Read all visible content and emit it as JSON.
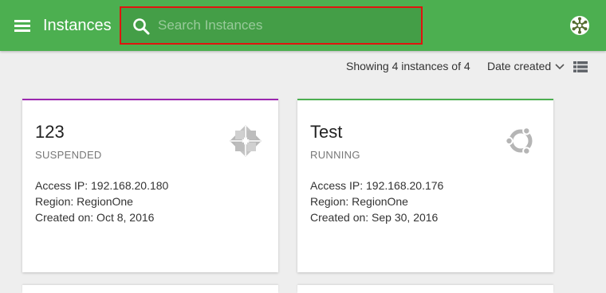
{
  "header": {
    "title": "Instances",
    "search_placeholder": "Search Instances",
    "search_value": "",
    "menu_icon": "hamburger-menu-icon",
    "search_icon": "magnifier-icon",
    "avatar_icon": "snowflake-avatar-icon",
    "color": "#4caf50",
    "highlight_color": "#e0140f"
  },
  "toolbar": {
    "count_text": "Showing 4 instances of 4",
    "sort_label": "Date created",
    "sort_icon": "chevron-down-icon",
    "view_icon": "list-view-icon"
  },
  "instances": [
    {
      "name": "123",
      "status": "SUSPENDED",
      "status_color": "#9c27b0",
      "access_ip": "Access IP: 192.168.20.180",
      "region": "Region: RegionOne",
      "created": "Created on: Oct 8, 2016",
      "os_icon": "centos-logo-icon"
    },
    {
      "name": "Test",
      "status": "RUNNING",
      "status_color": "#4caf50",
      "access_ip": "Access IP: 192.168.20.176",
      "region": "Region: RegionOne",
      "created": "Created on: Sep 30, 2016",
      "os_icon": "ubuntu-logo-icon"
    }
  ]
}
